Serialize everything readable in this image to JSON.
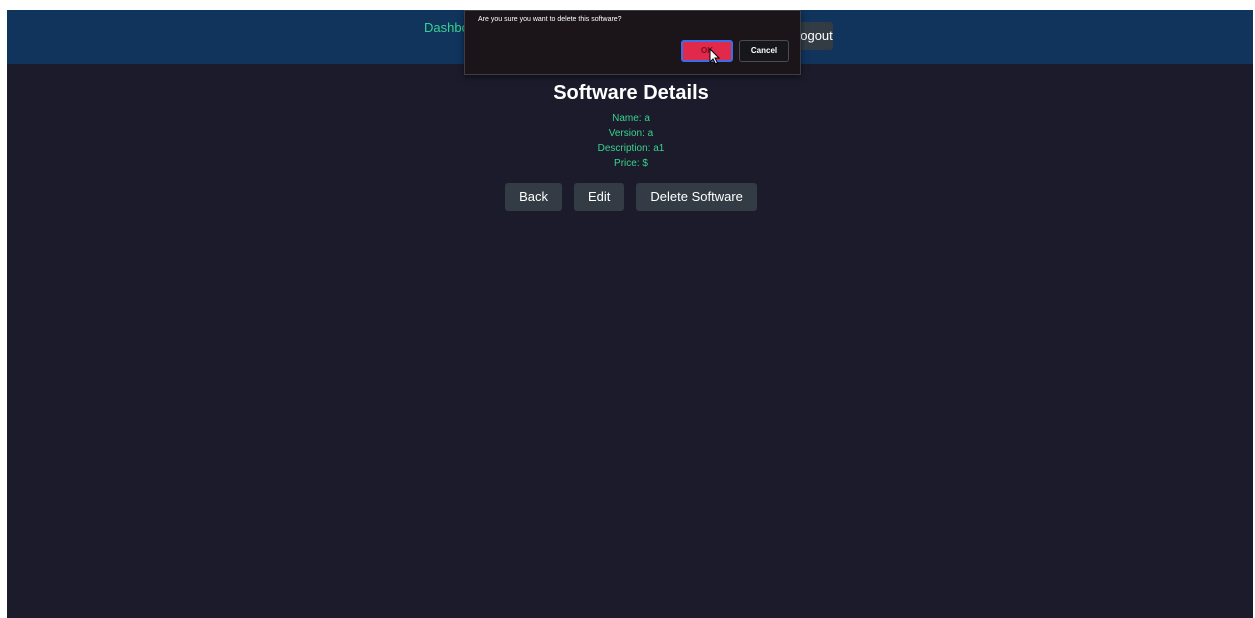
{
  "nav": {
    "dashboard_label": "Dashboard",
    "logout_label": "Logout"
  },
  "dialog": {
    "message": "Are you sure you want to delete this software?",
    "ok_label": "OK",
    "cancel_label": "Cancel"
  },
  "details": {
    "title": "Software Details",
    "name": "Name: a",
    "version": "Version: a",
    "description": "Description: a1",
    "price": "Price: $"
  },
  "actions": {
    "back_label": "Back",
    "edit_label": "Edit",
    "delete_label": "Delete Software"
  },
  "colors": {
    "page_background": "#1b1b2b",
    "header_background": "#10345c",
    "accent_text": "#39d38f",
    "button_background": "#333c44",
    "ok_button": "#e0294b",
    "focus_ring": "#3a6ee8"
  },
  "icons": {
    "cursor": "mouse-pointer-icon"
  }
}
